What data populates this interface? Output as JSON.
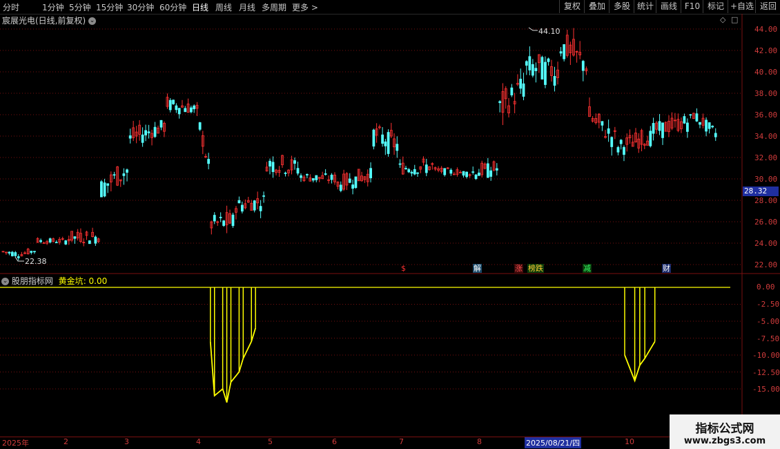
{
  "toolbar": {
    "timeframes": [
      "分时",
      "1分钟",
      "5分钟",
      "15分钟",
      "30分钟",
      "60分钟",
      "日线",
      "周线",
      "月线",
      "多周期",
      "更多"
    ],
    "right_buttons": [
      "复权",
      "叠加",
      "多股",
      "统计",
      "画线",
      "F10",
      "标记",
      "+自选",
      "返回"
    ]
  },
  "chart_title": {
    "name": "宸展光电(日线,前复权)"
  },
  "price_panel": {
    "axis_labels": [
      "44.00",
      "42.00",
      "40.00",
      "38.00",
      "36.00",
      "34.00",
      "32.00",
      "30.00",
      "28.00",
      "26.00",
      "24.00",
      "22.00"
    ],
    "current_price": "28.32",
    "high_label": "44.10",
    "low_label": "22.38",
    "markers": [
      "$",
      "解",
      "涨",
      "榜跌",
      "减",
      "财"
    ]
  },
  "indicator_panel": {
    "source": "股朋指标网",
    "name": "黄金坑",
    "value": "0.00",
    "axis_labels": [
      "0.00",
      "-2.50",
      "-5.00",
      "-7.50",
      "-10.00",
      "-12.50",
      "-15.00"
    ]
  },
  "date_axis": {
    "labels": [
      "2025年",
      "2",
      "3",
      "4",
      "5",
      "6",
      "7",
      "8",
      "2025/08/21/四",
      "10"
    ]
  },
  "watermark": {
    "title": "指标公式网",
    "url": "www.zbgs3.com"
  },
  "colors": {
    "up": "#ff3232",
    "down": "#54fcfc",
    "indicator": "#ffff00",
    "axis": "#d23c3c",
    "grid": "#7a1010"
  },
  "chart_data": [
    {
      "type": "candlestick",
      "title": "宸展光电(日线,前复权)",
      "y_range": [
        21.5,
        44.5
      ],
      "ohlc_trend": [
        [
          "2025-01-02",
          24.0,
          24.3,
          23.0,
          23.2
        ],
        [
          "2025-01-10",
          23.0,
          23.5,
          22.38,
          22.9
        ],
        [
          "2025-01-20",
          23.4,
          24.5,
          23.2,
          24.2
        ],
        [
          "2025-02-05",
          24.2,
          24.8,
          23.8,
          24.5
        ],
        [
          "2025-02-20",
          24.6,
          29.5,
          24.4,
          29.2
        ],
        [
          "2025-03-05",
          31.0,
          34.5,
          30.5,
          33.8
        ],
        [
          "2025-03-20",
          35.0,
          37.5,
          34.5,
          37.0
        ],
        [
          "2025-04-01",
          36.5,
          38.4,
          35.5,
          36.0
        ],
        [
          "2025-04-08",
          30.0,
          30.5,
          25.2,
          25.8
        ],
        [
          "2025-04-20",
          26.0,
          28.0,
          25.5,
          27.5
        ],
        [
          "2025-05-05",
          28.0,
          32.5,
          27.5,
          31.5
        ],
        [
          "2025-05-20",
          31.0,
          31.8,
          29.5,
          30.2
        ],
        [
          "2025-06-05",
          30.0,
          31.0,
          28.8,
          29.5
        ],
        [
          "2025-06-20",
          30.5,
          34.8,
          30.0,
          34.2
        ],
        [
          "2025-07-01",
          33.0,
          33.6,
          29.5,
          31.0
        ],
        [
          "2025-07-15",
          31.2,
          31.8,
          30.4,
          30.8
        ],
        [
          "2025-07-30",
          30.5,
          31.2,
          30.0,
          30.6
        ],
        [
          "2025-08-10",
          31.0,
          37.0,
          30.5,
          36.5
        ],
        [
          "2025-08-21",
          39.0,
          44.1,
          38.5,
          40.5
        ],
        [
          "2025-09-05",
          40.0,
          44.0,
          38.0,
          42.5
        ],
        [
          "2025-09-20",
          40.5,
          40.8,
          35.5,
          35.8
        ],
        [
          "2025-10-05",
          33.5,
          34.6,
          31.5,
          33.0
        ],
        [
          "2025-10-20",
          34.0,
          37.8,
          33.5,
          34.5
        ],
        [
          "2025-11-05",
          35.5,
          36.5,
          34.0,
          36.0
        ],
        [
          "2025-11-15",
          34.0,
          34.2,
          31.3,
          31.8
        ]
      ]
    },
    {
      "type": "bar",
      "title": "黄金坑",
      "y_range": [
        -17.5,
        1.5
      ],
      "series": [
        {
          "x": [
            "2025-04-08",
            "2025-04-10",
            "2025-04-14",
            "2025-04-16",
            "2025-04-18",
            "2025-04-22",
            "2025-04-24",
            "2025-04-28",
            "2025-04-30",
            "2025-10-09",
            "2025-10-13",
            "2025-10-15",
            "2025-10-17",
            "2025-10-21"
          ],
          "values": [
            -8.0,
            -16.0,
            -15.0,
            -17.0,
            -14.0,
            -12.5,
            -10.5,
            -8.0,
            -6.0,
            -10.0,
            -13.8,
            -11.5,
            -10.5,
            -8.0
          ]
        }
      ]
    }
  ]
}
